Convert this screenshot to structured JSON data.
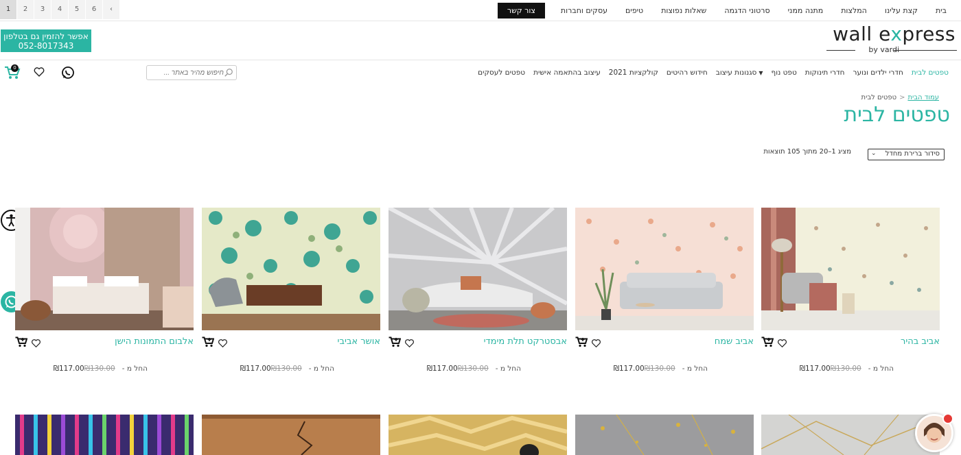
{
  "topnav": [
    "בית",
    "קצת עלינו",
    "המלצות",
    "מתנה ממני",
    "סרטוני הדגמה",
    "שאלות נפוצות",
    "טיפים",
    "עסקים וחברות",
    "צור קשר"
  ],
  "phone": {
    "line1": "אפשר להזמין גם בטלפון",
    "line2": "052-8017343"
  },
  "logo": {
    "wall": "wall e",
    "x": "x",
    "press": "press",
    "by": "by vardi"
  },
  "mainnav": [
    "טפטים לבית",
    "חדרי ילדים ונוער",
    "חדרי תינוקות",
    "טפט נוף",
    "סגנונות עיצוב",
    "חידוש רהיטים",
    "קולקציות 2021",
    "עיצוב בהתאמה אישית",
    "טפטים לעסקים"
  ],
  "search": {
    "placeholder": "חיפוש מהיר באתר ..."
  },
  "cart": {
    "count": "0"
  },
  "breadcrumb": {
    "home": "עמוד הבית",
    "sep": "<",
    "current": "טפטים לבית"
  },
  "page_title": "טפטים לבית",
  "sort": {
    "value": "סידור ברירת מחדל"
  },
  "result_count": "מציג 1–20 מתוך 105 תוצאות",
  "pagination": [
    "1",
    "2",
    "3",
    "4",
    "5",
    "6",
    "‹"
  ],
  "products": [
    {
      "name": "אביב בהיר",
      "from": "החל מ -",
      "price": "₪117.00",
      "old": "₪130.00"
    },
    {
      "name": "אביב שמח",
      "from": "החל מ -",
      "price": "₪117.00",
      "old": "₪130.00"
    },
    {
      "name": "אבסטרקט תלת מימדי",
      "from": "החל מ -",
      "price": "₪117.00",
      "old": "₪130.00"
    },
    {
      "name": "אושר אביבי",
      "from": "החל מ -",
      "price": "₪117.00",
      "old": "₪130.00"
    },
    {
      "name": "אלבום התמונות הישן",
      "from": "החל מ -",
      "price": "₪117.00",
      "old": "₪130.00"
    }
  ],
  "colors": {
    "accent": "#2bb5a3",
    "dark": "#111111"
  }
}
